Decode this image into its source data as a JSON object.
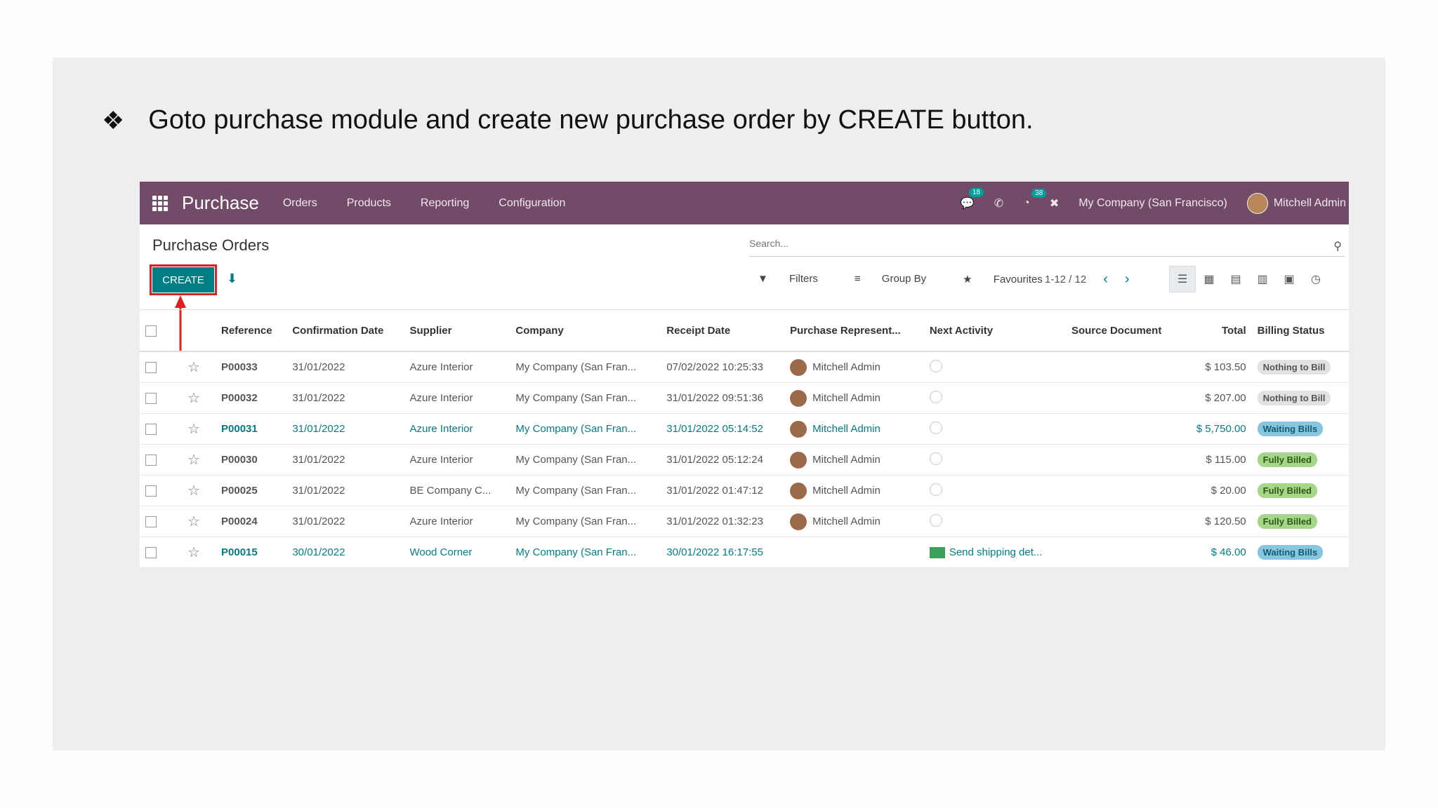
{
  "instruction": {
    "bullet": "❖",
    "text": "Goto purchase module and create new purchase order by CREATE button."
  },
  "navbar": {
    "brand": "Purchase",
    "menu": [
      "Orders",
      "Products",
      "Reporting",
      "Configuration"
    ],
    "chat_count": "18",
    "activity_count": "38",
    "company": "My Company (San Francisco)",
    "user": "Mitchell Admin"
  },
  "control_panel": {
    "title": "Purchase Orders",
    "search_placeholder": "Search...",
    "create_label": "CREATE",
    "filters_label": "Filters",
    "group_by_label": "Group By",
    "favourites_label": "Favourites",
    "pager": "1-12 / 12"
  },
  "table": {
    "headers": [
      "Reference",
      "Confirmation Date",
      "Supplier",
      "Company",
      "Receipt Date",
      "Purchase Represent...",
      "Next Activity",
      "Source Document",
      "Total",
      "Billing Status"
    ],
    "rows": [
      {
        "ref": "P00033",
        "conf": "31/01/2022",
        "supplier": "Azure Interior",
        "company": "My Company (San Fran...",
        "receipt": "07/02/2022 10:25:33",
        "rep": "Mitchell Admin",
        "activity": "",
        "source": "",
        "total": "$ 103.50",
        "status": "Nothing to Bill",
        "status_kind": "nothing",
        "highlight": false
      },
      {
        "ref": "P00032",
        "conf": "31/01/2022",
        "supplier": "Azure Interior",
        "company": "My Company (San Fran...",
        "receipt": "31/01/2022 09:51:36",
        "rep": "Mitchell Admin",
        "activity": "",
        "source": "",
        "total": "$ 207.00",
        "status": "Nothing to Bill",
        "status_kind": "nothing",
        "highlight": false
      },
      {
        "ref": "P00031",
        "conf": "31/01/2022",
        "supplier": "Azure Interior",
        "company": "My Company (San Fran...",
        "receipt": "31/01/2022 05:14:52",
        "rep": "Mitchell Admin",
        "activity": "",
        "source": "",
        "total": "$ 5,750.00",
        "status": "Waiting Bills",
        "status_kind": "waiting",
        "highlight": true
      },
      {
        "ref": "P00030",
        "conf": "31/01/2022",
        "supplier": "Azure Interior",
        "company": "My Company (San Fran...",
        "receipt": "31/01/2022 05:12:24",
        "rep": "Mitchell Admin",
        "activity": "",
        "source": "",
        "total": "$ 115.00",
        "status": "Fully Billed",
        "status_kind": "full",
        "highlight": false
      },
      {
        "ref": "P00025",
        "conf": "31/01/2022",
        "supplier": "BE Company C...",
        "company": "My Company (San Fran...",
        "receipt": "31/01/2022 01:47:12",
        "rep": "Mitchell Admin",
        "activity": "",
        "source": "",
        "total": "$ 20.00",
        "status": "Fully Billed",
        "status_kind": "full",
        "highlight": false
      },
      {
        "ref": "P00024",
        "conf": "31/01/2022",
        "supplier": "Azure Interior",
        "company": "My Company (San Fran...",
        "receipt": "31/01/2022 01:32:23",
        "rep": "Mitchell Admin",
        "activity": "",
        "source": "",
        "total": "$ 120.50",
        "status": "Fully Billed",
        "status_kind": "full",
        "highlight": false
      },
      {
        "ref": "P00015",
        "conf": "30/01/2022",
        "supplier": "Wood Corner",
        "company": "My Company (San Fran...",
        "receipt": "30/01/2022 16:17:55",
        "rep": "",
        "activity": "Send shipping det...",
        "source": "",
        "total": "$ 46.00",
        "status": "Waiting Bills",
        "status_kind": "waiting",
        "highlight": true
      }
    ]
  },
  "colors": {
    "navbar": "#714b67",
    "primary": "#017e84",
    "highlight_box": "#e02020"
  }
}
